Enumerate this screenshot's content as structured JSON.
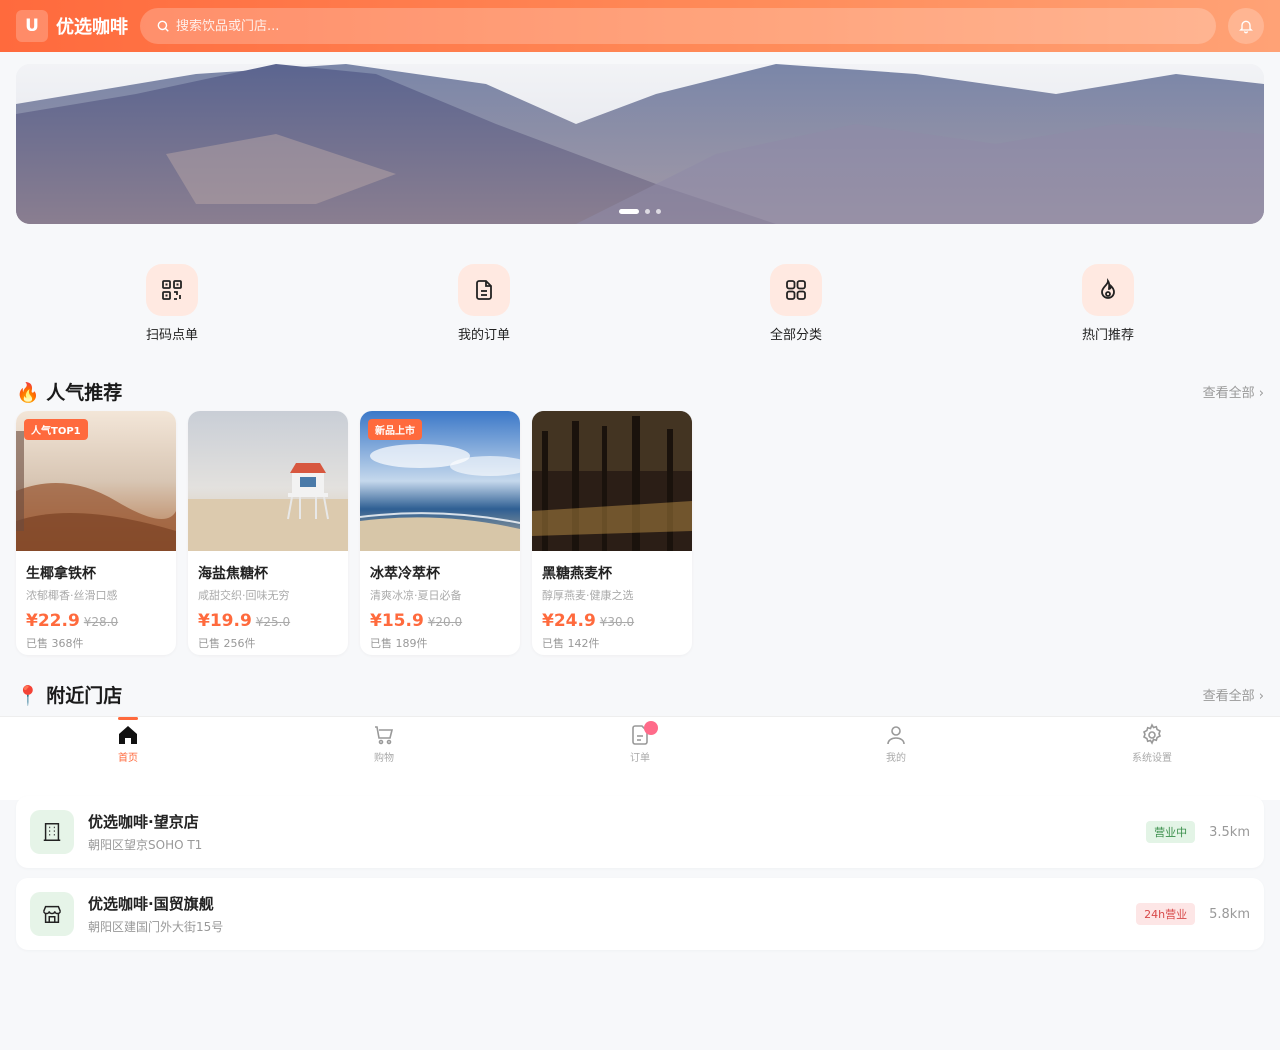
{
  "header": {
    "logo_letter": "U",
    "app_name": "优选咖啡",
    "search_placeholder": "搜索饮品或门店...",
    "accent": "#ff6a3d"
  },
  "banner": {
    "slides": 3,
    "active_slide": 1
  },
  "quick_actions": [
    {
      "label": "扫码点单",
      "icon": "qrcode-icon"
    },
    {
      "label": "我的订单",
      "icon": "document-icon"
    },
    {
      "label": "全部分类",
      "icon": "grid-icon"
    },
    {
      "label": "热门推荐",
      "icon": "flame-icon"
    }
  ],
  "products_section": {
    "title": "🔥 人气推荐",
    "more": "查看全部"
  },
  "products": [
    {
      "name": "生椰拿铁杯",
      "sub": "浓郁椰香·丝滑口感",
      "price": "¥22.9",
      "old_price": "¥28.0",
      "sold": "已售 368件",
      "tag": "人气TOP1"
    },
    {
      "name": "海盐焦糖杯",
      "sub": "咸甜交织·回味无穷",
      "price": "¥19.9",
      "old_price": "¥25.0",
      "sold": "已售 256件",
      "tag": ""
    },
    {
      "name": "冰萃冷萃杯",
      "sub": "清爽冰凉·夏日必备",
      "price": "¥15.9",
      "old_price": "¥20.0",
      "sold": "已售 189件",
      "tag": "新品上市"
    },
    {
      "name": "黑糖燕麦杯",
      "sub": "醇厚燕麦·健康之选",
      "price": "¥24.9",
      "old_price": "¥30.0",
      "sold": "已售 142件",
      "tag": ""
    }
  ],
  "stores_section": {
    "title": "📍 附近门店",
    "more": "查看全部"
  },
  "stores": [
    {
      "name": "优选咖啡·望京店",
      "address": "朝阳区望京SOHO T1",
      "status": "营业中",
      "distance": "3.5km"
    },
    {
      "name": "优选咖啡·国贸旗舰",
      "address": "朝阳区建国门外大街15号",
      "status": "24h营业",
      "distance": "5.8km"
    }
  ],
  "tabbar": [
    {
      "label": "首页",
      "icon": "home-icon",
      "active": true
    },
    {
      "label": "购物",
      "icon": "cart-icon",
      "active": false
    },
    {
      "label": "订单",
      "icon": "order-icon",
      "active": false,
      "badge": true
    },
    {
      "label": "我的",
      "icon": "user-icon",
      "active": false
    },
    {
      "label": "系统设置",
      "icon": "gear-icon",
      "active": false
    }
  ]
}
